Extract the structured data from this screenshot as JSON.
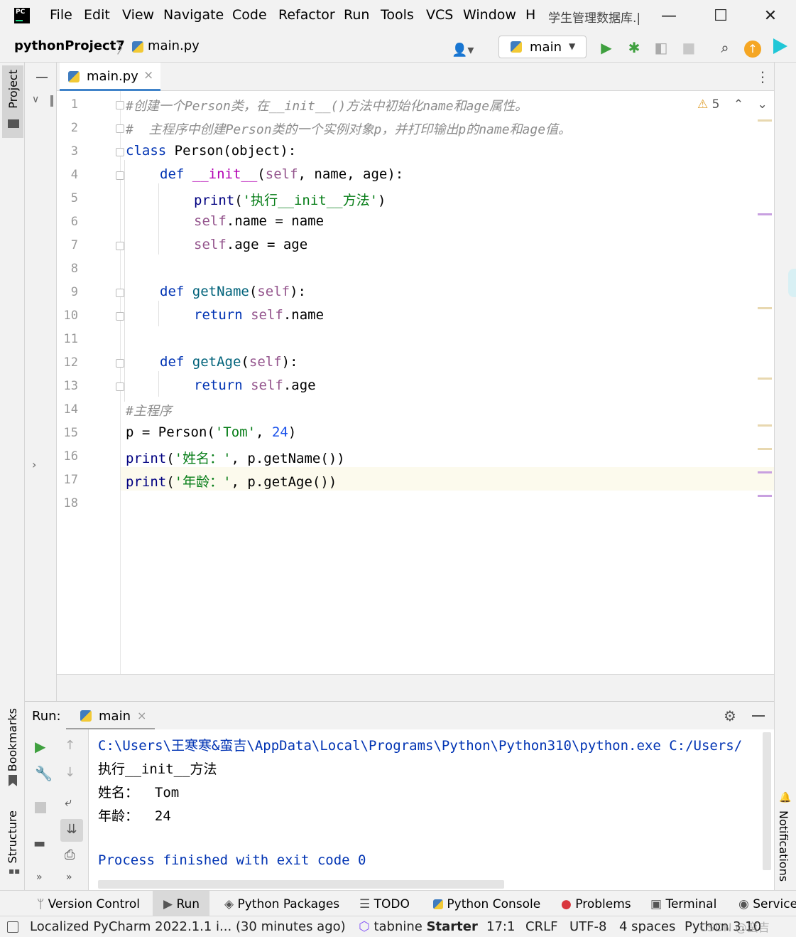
{
  "app": {
    "logo_text": "PC",
    "menu": [
      {
        "label": "File"
      },
      {
        "label": "Edit"
      },
      {
        "label": "View"
      },
      {
        "label": "Navigate"
      },
      {
        "label": "Code"
      },
      {
        "label": "Refactor"
      },
      {
        "label": "Run"
      },
      {
        "label": "Tools"
      },
      {
        "label": "VCS"
      },
      {
        "label": "Window"
      },
      {
        "label": "H"
      }
    ],
    "window_title": "学生管理数据库.|",
    "window_controls": {
      "minimize": "—",
      "maximize": "☐",
      "close": "✕"
    }
  },
  "navbar": {
    "project": "pythonProject7",
    "separator": "〉",
    "file": "main.py",
    "run_config": "main"
  },
  "side_tabs": {
    "project": "Project",
    "bookmarks": "Bookmarks",
    "structure": "Structure",
    "notifications": "Notifications"
  },
  "editor": {
    "tab": {
      "label": "main.py",
      "close": "×"
    },
    "inspections": {
      "icon": "warning-icon",
      "count": "5"
    },
    "line_numbers": [
      "1",
      "2",
      "3",
      "4",
      "5",
      "6",
      "7",
      "8",
      "9",
      "10",
      "11",
      "12",
      "13",
      "14",
      "15",
      "16",
      "17",
      "18"
    ],
    "lines": {
      "l1": "#创建一个Person类，在__init__()方法中初始化name和age属性。",
      "l2": "#  主程序中创建Person类的一个实例对象p，并打印输出p的name和age值。",
      "l3_kw": "class",
      "l3_rest": " Person(object):",
      "l4_kw": "def",
      "l4_fn": "__init__",
      "l4_open": "(",
      "l4_self": "self",
      "l4_rest": ", name, age):",
      "l5_fn": "print",
      "l5_open": "(",
      "l5_str": "'执行__init__方法'",
      "l5_close": ")",
      "l6_self": "self",
      "l6_rest": ".name = name",
      "l7_self": "self",
      "l7_rest": ".age = age",
      "l9_kw": "def",
      "l9_fn": "getName",
      "l9_open": "(",
      "l9_self": "self",
      "l9_close": "):",
      "l10_kw": "return",
      "l10_self": "self",
      "l10_rest": ".name",
      "l12_kw": "def",
      "l12_fn": "getAge",
      "l12_open": "(",
      "l12_self": "self",
      "l12_close": "):",
      "l13_kw": "return",
      "l13_self": "self",
      "l13_rest": ".age",
      "l14": "#主程序",
      "l15_a": "p = Person(",
      "l15_str": "'Tom'",
      "l15_b": ", ",
      "l15_num": "24",
      "l15_c": ")",
      "l16_fn": "print",
      "l16_open": "(",
      "l16_str": "'姓名：'",
      "l16_rest": ", p.getName())",
      "l17_fn": "print",
      "l17_open": "(",
      "l17_str": "'年龄：'",
      "l17_rest": ", p.getAge())"
    }
  },
  "run_panel": {
    "label": "Run:",
    "tab": "main",
    "tab_close": "×",
    "console": [
      "C:\\Users\\王寒寒&蛮吉\\AppData\\Local\\Programs\\Python\\Python310\\python.exe C:/Users/",
      "执行__init__方法",
      "姓名：  Tom",
      "年龄：  24",
      "",
      "Process finished with exit code 0"
    ]
  },
  "tool_tabs": [
    "Version Control",
    "Run",
    "Python Packages",
    "TODO",
    "Python Console",
    "Problems",
    "Terminal",
    "Services"
  ],
  "status_bar": {
    "message": "Localized PyCharm 2022.1.1 i... (30 minutes ago)",
    "tabnine": "tabnine",
    "tabnine_plan": "Starter",
    "position": "17:1",
    "line_sep": "CRLF",
    "encoding": "UTF-8",
    "indent": "4 spaces",
    "interpreter": "Python 3.10",
    "watermark": "CSDN @蛮吉"
  },
  "colors": {
    "keyword": "#0033b3",
    "self": "#94558d",
    "string": "#067d17",
    "number": "#1750eb",
    "comment": "#8c8c8c",
    "run_green": "#3fa03f",
    "accent_blue": "#4083c9"
  }
}
